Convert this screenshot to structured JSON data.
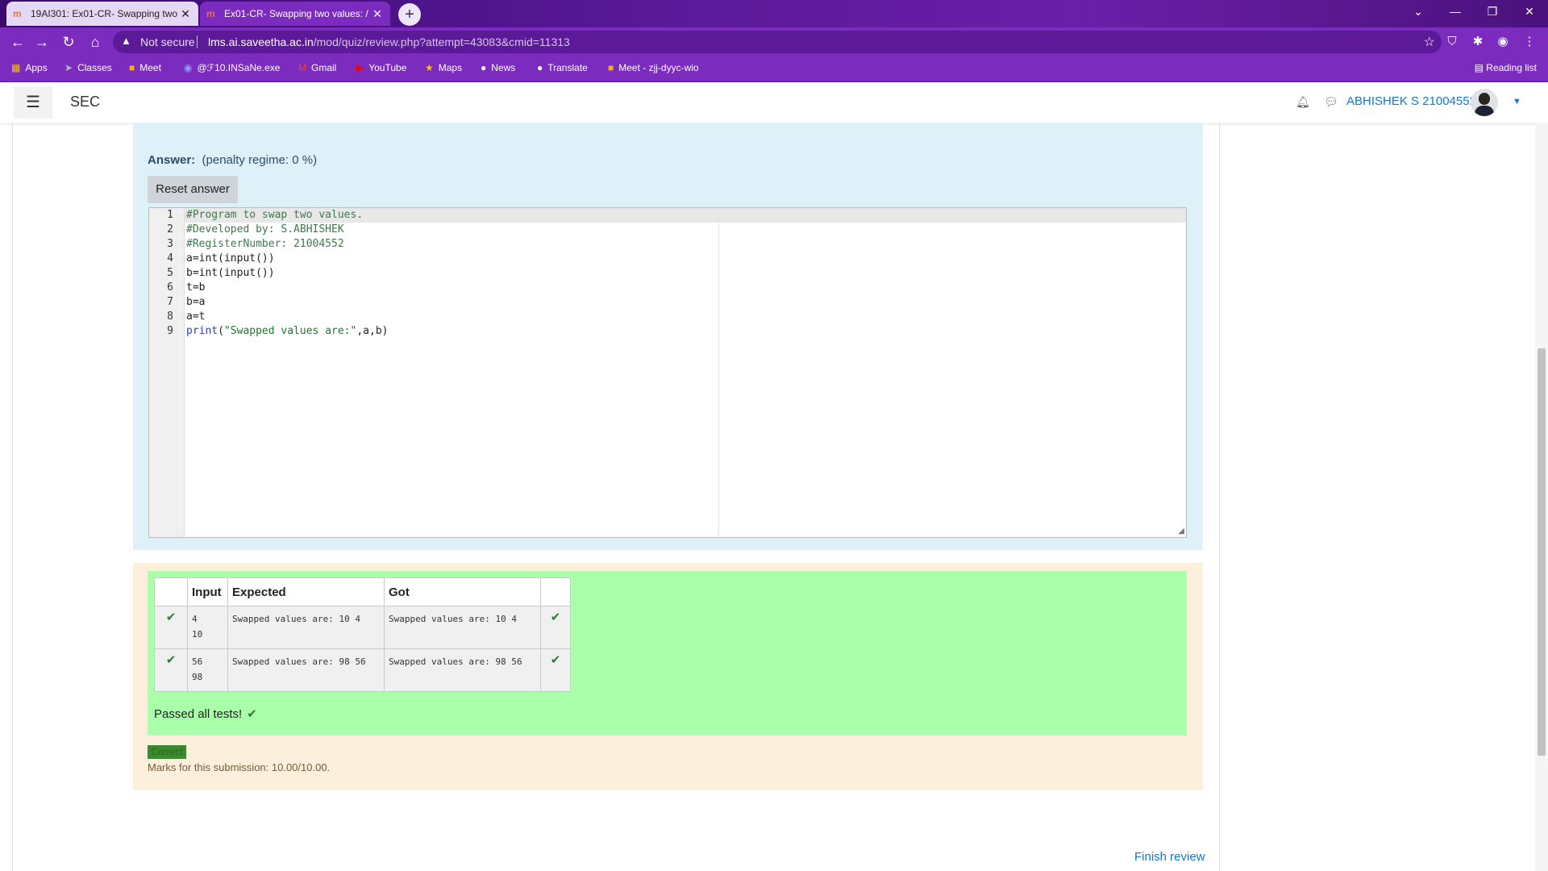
{
  "browser": {
    "tabs": [
      {
        "title": "19AI301: Ex01-CR- Swapping two",
        "close": "✕"
      },
      {
        "title": "Ex01-CR- Swapping two values: /",
        "close": "✕"
      }
    ],
    "new_tab": "+",
    "security_label": "Not secure",
    "url_host": "lms.ai.saveetha.ac.in",
    "url_path": "/mod/quiz/review.php?attempt=43083&cmid=11313",
    "bookmarks": [
      {
        "label": "Apps",
        "icon": "apps-grid-icon"
      },
      {
        "label": "Classes",
        "icon": "classes-icon"
      },
      {
        "label": "Meet",
        "icon": "meet-icon"
      },
      {
        "label": "@ℱ10.INSaNe.exe",
        "icon": "discord-icon"
      },
      {
        "label": "Gmail",
        "icon": "gmail-icon"
      },
      {
        "label": "YouTube",
        "icon": "youtube-icon"
      },
      {
        "label": "Maps",
        "icon": "maps-icon"
      },
      {
        "label": "News",
        "icon": "github-icon"
      },
      {
        "label": "Translate",
        "icon": "github-icon"
      },
      {
        "label": "Meet - zjj-dyyc-wio",
        "icon": "meet-icon"
      }
    ],
    "reading_list": "Reading list"
  },
  "navbar": {
    "brand": "SEC",
    "user_name": "ABHISHEK S 21004552"
  },
  "question": {
    "answer_label": "Answer:",
    "penalty": "(penalty regime: 0 %)",
    "reset_button": "Reset answer",
    "code_lines": [
      "#Program to swap two values.",
      "#Developed by: S.ABHISHEK",
      "#RegisterNumber: 21004552",
      "a=int(input())",
      "b=int(input())",
      "t=b",
      "b=a",
      "a=t",
      "print(\"Swapped values are:\",a,b)"
    ],
    "line_numbers": [
      "1",
      "2",
      "3",
      "4",
      "5",
      "6",
      "7",
      "8",
      "9"
    ]
  },
  "results": {
    "headers": [
      "Input",
      "Expected",
      "Got"
    ],
    "rows": [
      {
        "input_a": "4",
        "input_b": "10",
        "expected": "Swapped values are: 10 4",
        "got": "Swapped values are: 10 4",
        "mark": "✔"
      },
      {
        "input_a": "56",
        "input_b": "98",
        "expected": "Swapped values are: 98 56",
        "got": "Swapped values are: 98 56",
        "mark": "✔"
      }
    ],
    "passed": "Passed all tests!",
    "badge": "Correct",
    "marks": "Marks for this submission: 10.00/10.00."
  },
  "footer": {
    "finish_review": "Finish review"
  },
  "colors": {
    "chrome_accent": "#7b2cbf",
    "link_blue": "#1177d1",
    "pass_green": "#aaffaa",
    "question_blue": "#def1f8",
    "feedback_orange": "#fcefdc"
  }
}
